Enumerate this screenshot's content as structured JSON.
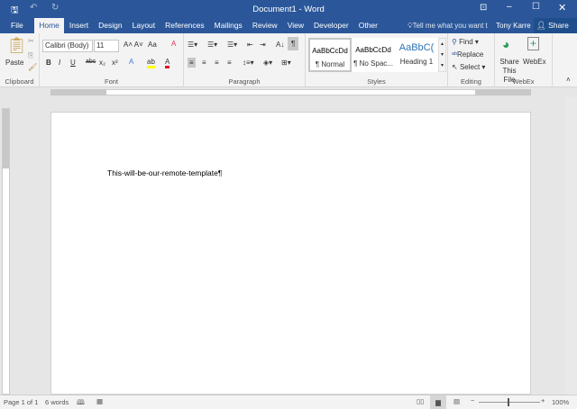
{
  "window": {
    "title": "Document1 - Word",
    "user": "Tony Karre",
    "share": "Share",
    "tell_me": "Tell me what you want t"
  },
  "tabs": [
    "File",
    "Home",
    "Insert",
    "Design",
    "Layout",
    "References",
    "Mailings",
    "Review",
    "View",
    "Developer",
    "Other"
  ],
  "ribbon": {
    "clipboard": {
      "label": "Clipboard",
      "paste": "Paste"
    },
    "font": {
      "label": "Font",
      "font_name": "Calibri (Body)",
      "font_size": "11",
      "change_case": "Aa"
    },
    "paragraph": {
      "label": "Paragraph"
    },
    "styles": {
      "label": "Styles",
      "items": [
        {
          "preview": "AaBbCcDd",
          "name": "¶ Normal"
        },
        {
          "preview": "AaBbCcDd",
          "name": "¶ No Spac..."
        },
        {
          "preview": "AaBbC(",
          "name": "Heading 1"
        }
      ]
    },
    "editing": {
      "label": "Editing",
      "find": "Find",
      "replace": "Replace",
      "select": "Select"
    },
    "webex": {
      "label": "WebEx",
      "share_file": "Share This File",
      "webex": "WebEx"
    }
  },
  "document": {
    "text": "This-will-be-our-remote-template¶"
  },
  "status": {
    "page": "Page 1 of 1",
    "words": "6 words",
    "zoom": "100%",
    "zoom_percent": 100
  },
  "colors": {
    "brand": "#2b579a",
    "highlight": "#ffff00",
    "font_color": "#e81123"
  }
}
